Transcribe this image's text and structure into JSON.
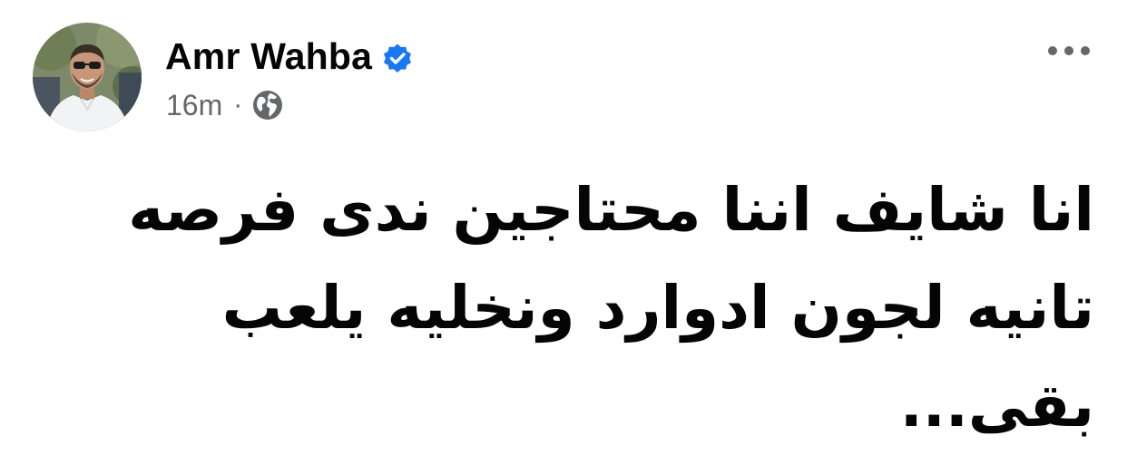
{
  "post": {
    "author": {
      "name": "Amr Wahba",
      "verified": true,
      "avatar_icon": "profile-photo"
    },
    "timestamp": "16m",
    "separator": "·",
    "audience_icon": "globe-icon",
    "more_icon": "more-options-icon",
    "text_lines": [
      "انا شايف اننا محتاجين ندى فرصه",
      "تانيه لجون ادوارد ونخليه يلعب",
      "بقى..."
    ]
  },
  "colors": {
    "text": "#050505",
    "secondary_text": "#65676b",
    "verified_badge": "#1877f2",
    "icon_gray": "#65676b"
  }
}
